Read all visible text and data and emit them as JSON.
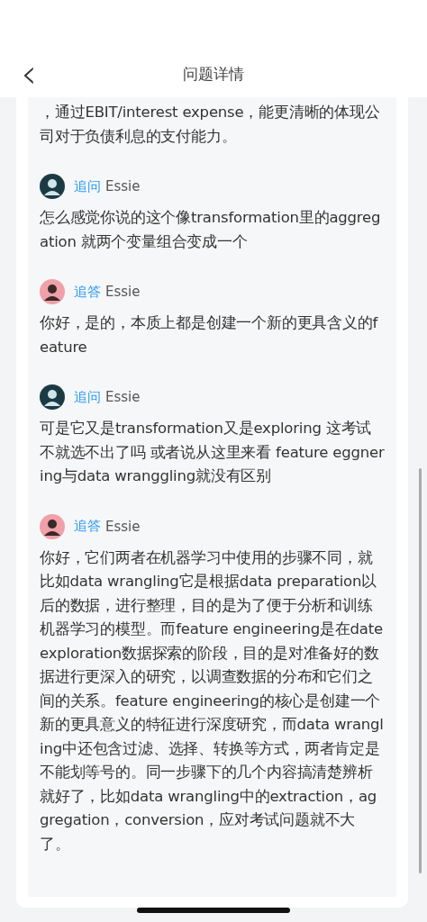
{
  "header": {
    "back": "‹",
    "title": "问题详情"
  },
  "lead_text": "，通过EBIT/interest expense，能更清晰的体现公司对于负债利息的支付能力。",
  "entries": [
    {
      "kind": "question",
      "label": "追问",
      "author": "Essie",
      "text": "怎么感觉你说的这个像transformation里的aggregation  就两个变量组合变成一个"
    },
    {
      "kind": "answer",
      "label": "追答",
      "author": "Essie",
      "text": "你好，是的，本质上都是创建一个新的更具含义的feature"
    },
    {
      "kind": "question",
      "label": "追问",
      "author": "Essie",
      "text": "可是它又是transformation又是exploring 这考试不就选不出了吗  或者说从这里来看  feature eggnering与data wranggling就没有区别"
    },
    {
      "kind": "answer",
      "label": "追答",
      "author": "Essie",
      "text": "你好，它们两者在机器学习中使用的步骤不同，就比如data wrangling它是根据data preparation以后的数据，进行整理，目的是为了便于分析和训练机器学习的模型。而feature engineering是在date exploration数据探索的阶段，目的是对准备好的数据进行更深入的研究，以调查数据的分布和它们之间的关系。feature engineering的核心是创建一个新的更具意义的特征进行深度研究，而data wrangling中还包含过滤、选择、转换等方式，两者肯定是不能划等号的。同一步骤下的几个内容搞清楚辨析就好了，比如data wrangling中的extraction，aggregation，conversion，应对考试问题就不大了。"
    }
  ]
}
